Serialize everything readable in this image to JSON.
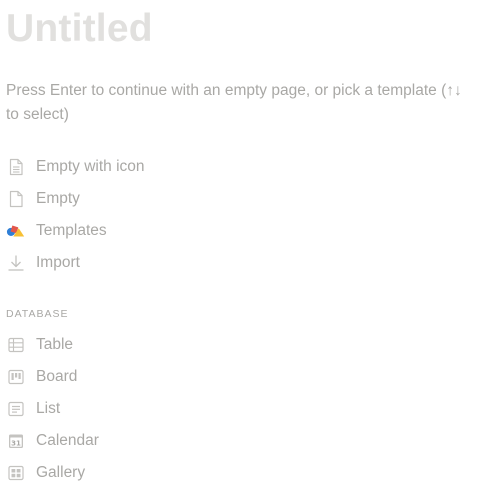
{
  "page": {
    "title": "Untitled",
    "hint": "Press Enter to continue with an empty page, or pick a template (↑↓ to select)"
  },
  "options": {
    "items": [
      {
        "label": "Empty with icon",
        "icon": "document-lines-icon"
      },
      {
        "label": "Empty",
        "icon": "document-icon"
      },
      {
        "label": "Templates",
        "icon": "templates-shapes-icon"
      },
      {
        "label": "Import",
        "icon": "download-icon"
      }
    ]
  },
  "database": {
    "header": "DATABASE",
    "items": [
      {
        "label": "Table",
        "icon": "table-icon"
      },
      {
        "label": "Board",
        "icon": "board-icon"
      },
      {
        "label": "List",
        "icon": "list-icon"
      },
      {
        "label": "Calendar",
        "icon": "calendar-icon",
        "icon_text": "31"
      },
      {
        "label": "Gallery",
        "icon": "gallery-icon"
      }
    ]
  },
  "colors": {
    "title": "#e1e0de",
    "text": "#a9a8a5",
    "icon": "#c4c3c0",
    "template_blue": "#2f7fd6",
    "template_red": "#e3574b",
    "template_yellow": "#f7c035"
  }
}
